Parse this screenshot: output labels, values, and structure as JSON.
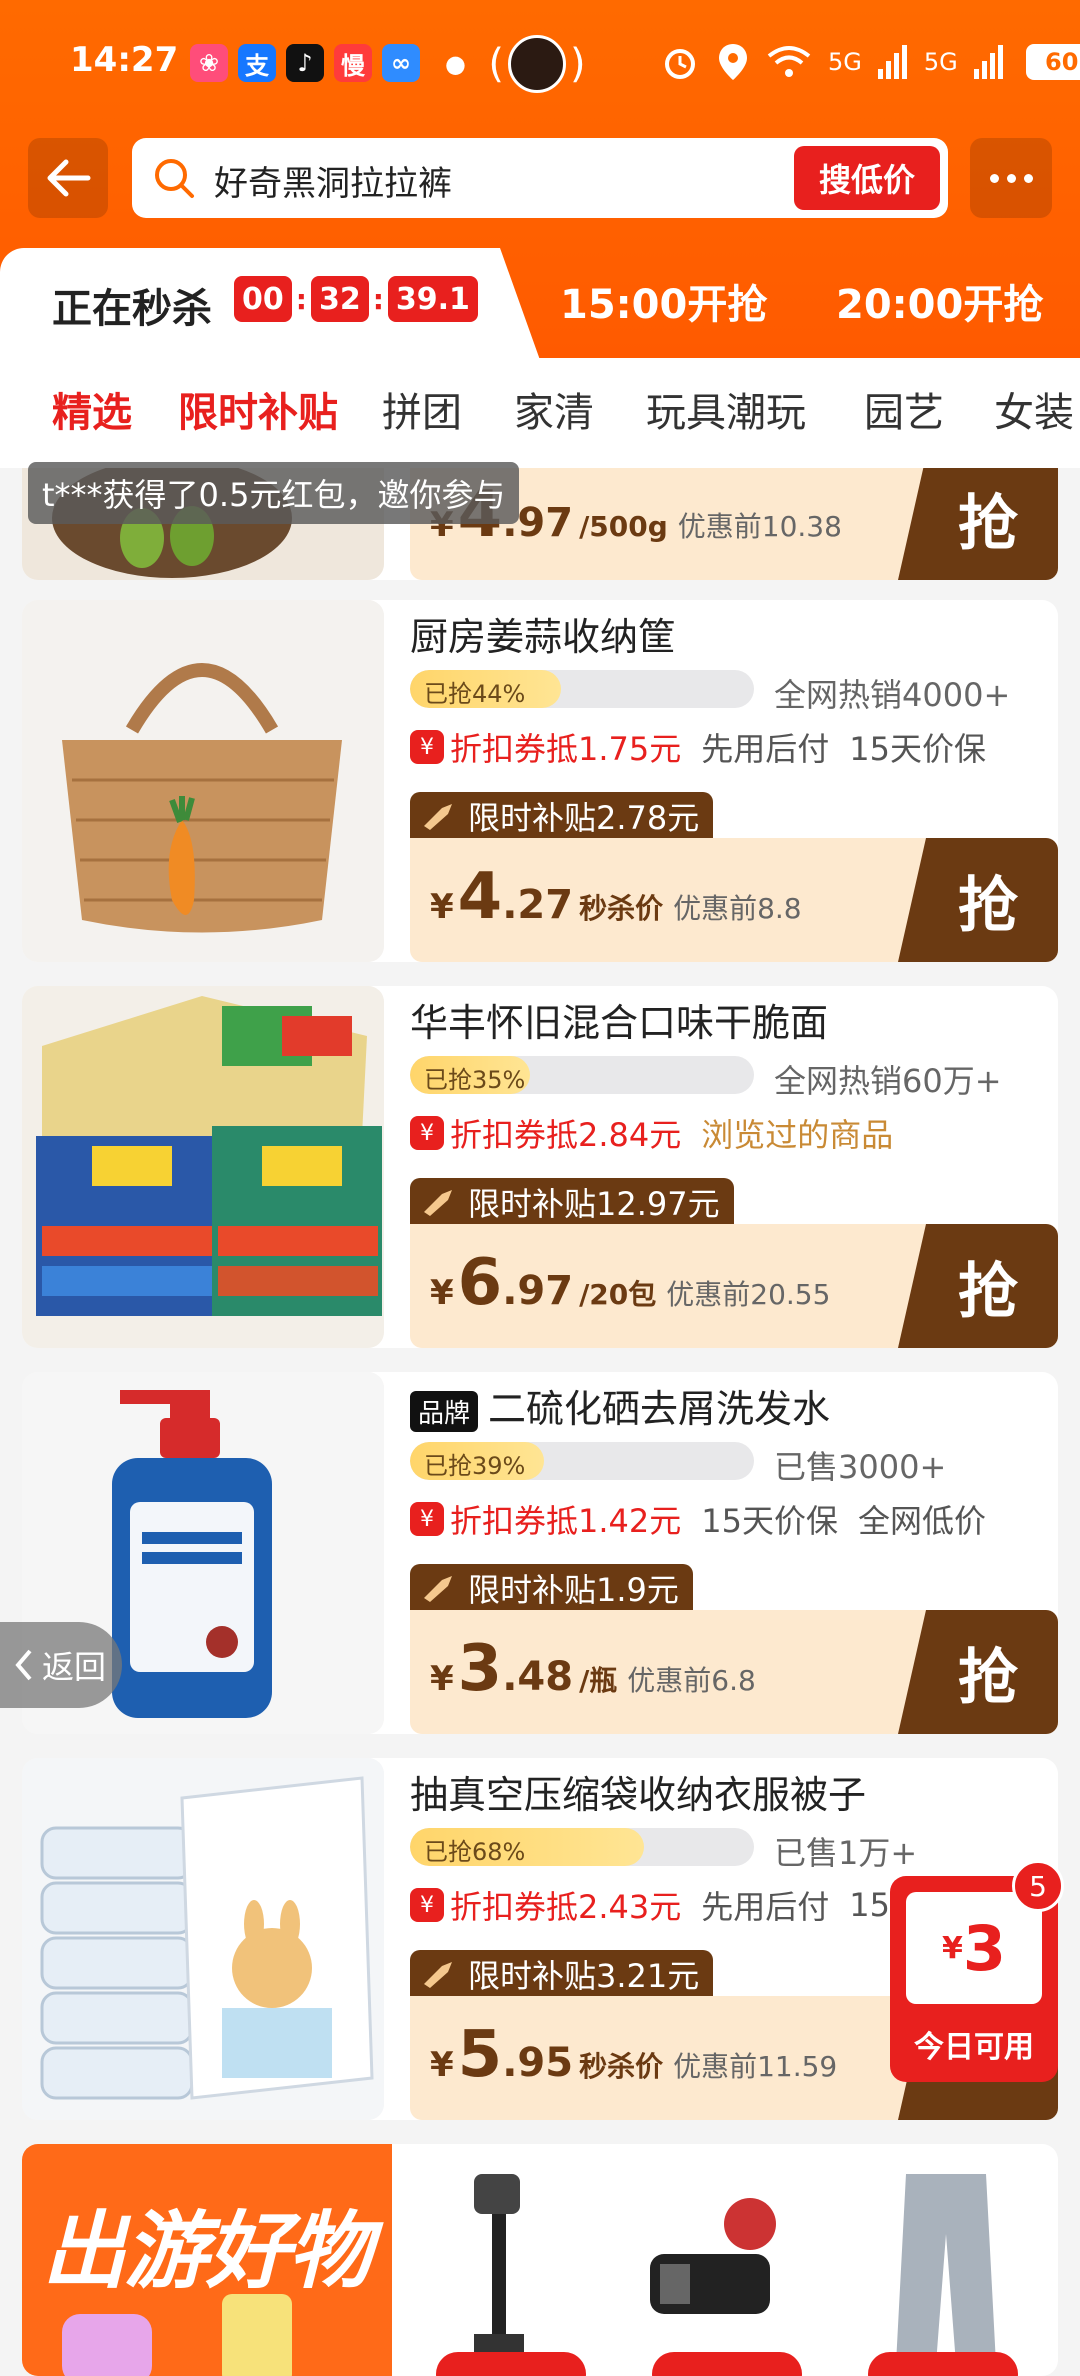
{
  "status_bar": {
    "time": "14:27",
    "battery": "60",
    "network_labels": [
      "5G",
      "5G"
    ]
  },
  "search": {
    "query": "好奇黑洞拉拉裤",
    "button": "搜低价"
  },
  "sessions": {
    "active_label": "正在秒杀",
    "countdown": [
      "00",
      "32",
      "39.1"
    ],
    "next": [
      "15:00开抢",
      "20:00开抢"
    ]
  },
  "categories": [
    "精选",
    "限时补贴",
    "拼团",
    "家清",
    "玩具潮玩",
    "园艺",
    "女装"
  ],
  "toast": "t***获得了0.5元红包，邀你参与",
  "products": [
    {
      "title": "",
      "subsidy": "",
      "price_int": "4",
      "price_dec": ".97",
      "unit": "/500g",
      "original": "优惠前10.38",
      "grab": "抢"
    },
    {
      "title": "厨房姜蒜收纳筐",
      "brand": "",
      "sold_pct_label": "已抢44%",
      "sold_pct": 44,
      "sales": "全网热销4000+",
      "coupon": "折扣券抵1.75元",
      "tags": [
        "先用后付",
        "15天价保"
      ],
      "viewed": "",
      "subsidy": "限时补贴2.78元",
      "price_int": "4",
      "price_dec": ".27",
      "unit": "秒杀价",
      "original": "优惠前8.8",
      "grab": "抢"
    },
    {
      "title": "华丰怀旧混合口味干脆面",
      "brand": "",
      "sold_pct_label": "已抢35%",
      "sold_pct": 35,
      "sales": "全网热销60万+",
      "coupon": "折扣券抵2.84元",
      "tags": [],
      "viewed": "浏览过的商品",
      "subsidy": "限时补贴12.97元",
      "price_int": "6",
      "price_dec": ".97",
      "unit": "/20包",
      "original": "优惠前20.55",
      "grab": "抢"
    },
    {
      "title": "二硫化硒去屑洗发水",
      "brand": "品牌",
      "sold_pct_label": "已抢39%",
      "sold_pct": 39,
      "sales": "已售3000+",
      "coupon": "折扣券抵1.42元",
      "tags": [
        "15天价保",
        "全网低价"
      ],
      "viewed": "",
      "subsidy": "限时补贴1.9元",
      "price_int": "3",
      "price_dec": ".48",
      "unit": "/瓶",
      "original": "优惠前6.8",
      "grab": "抢"
    },
    {
      "title": "抽真空压缩袋收纳衣服被子",
      "brand": "",
      "sold_pct_label": "已抢68%",
      "sold_pct": 68,
      "sales": "已售1万+",
      "coupon": "折扣券抵2.43元",
      "tags": [
        "先用后付",
        "15"
      ],
      "viewed": "",
      "subsidy": "限时补贴3.21元",
      "price_int": "5",
      "price_dec": ".95",
      "unit": "秒杀价",
      "original": "优惠前11.59",
      "grab": ""
    }
  ],
  "return_button": "返回",
  "coupon_float": {
    "yen": "¥",
    "amount": "3",
    "label": "今日可用",
    "badge": "5"
  },
  "banner": {
    "title": "出游好物"
  },
  "colors": {
    "brand_orange": "#ff6a00",
    "accent_red": "#e8201e",
    "subsidy_brown": "#6b3a12",
    "price_bg": "#fde9cf"
  }
}
